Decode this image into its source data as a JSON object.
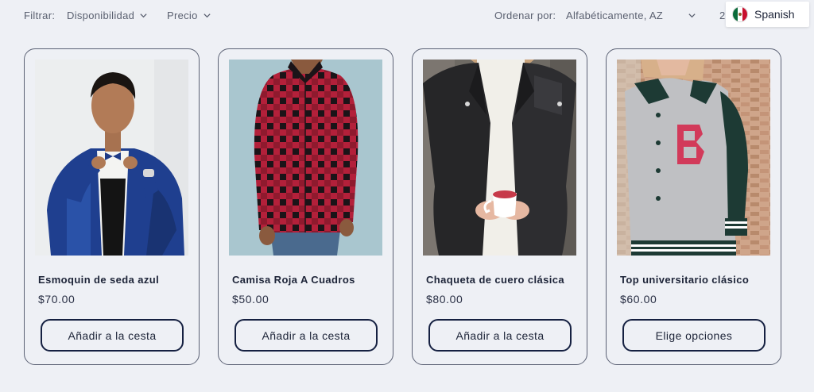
{
  "toolbar": {
    "filter_label": "Filtrar:",
    "availability_label": "Disponibilidad",
    "price_label": "Precio",
    "sort_label": "Ordenar por:",
    "sort_value": "Alfabéticamente, AZ",
    "count_partial": "2"
  },
  "language": {
    "label": "Spanish",
    "flag_icon": "mexico-flag-icon"
  },
  "products": [
    {
      "title": "Esmoquin de seda azul",
      "price": "$70.00",
      "button": "Añadir a la cesta"
    },
    {
      "title": "Camisa Roja A Cuadros",
      "price": "$50.00",
      "button": "Añadir a la cesta"
    },
    {
      "title": "Chaqueta de cuero clásica",
      "price": "$80.00",
      "button": "Añadir a la cesta"
    },
    {
      "title": "Top universitario clásico",
      "price": "$60.00",
      "button": "Elige opciones"
    }
  ],
  "colors": {
    "background": "#eef0f5",
    "text": "#1d2438",
    "button_border": "#152041",
    "card_border": "#5c6275"
  }
}
